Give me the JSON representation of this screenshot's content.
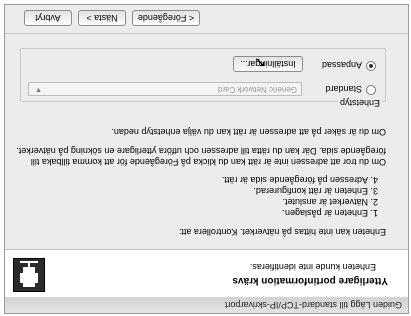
{
  "window": {
    "title": "Guiden Lägg till standard-TCP/IP-skrivarport"
  },
  "header": {
    "title": "Ytterligare portinformation krävs",
    "subtitle": "Enheten kunde inte identifieras.",
    "icon": "printer-network-icon"
  },
  "body": {
    "intro": "Enheten kan inte hittas på nätverket. Kontrollera att:",
    "checklist": [
      {
        "num": "1.",
        "text": "Enheten är påslagen."
      },
      {
        "num": "2.",
        "text": "Nätverket är anslutet."
      },
      {
        "num": "3.",
        "text": "Enheten är rätt konfigurerad."
      },
      {
        "num": "4.",
        "text": "Adressen på föregående sida är rätt."
      }
    ],
    "para1_line1": "Om du tror att adressen inte är rätt kan du klicka på Föregående för att komma tillbaka till",
    "para1_line2": "föregående sida. Där kan du rätta till adressen och utföra ytterligare en sökning på nätverket.",
    "para2": "Om du är säker på att adressen är rätt kan du välja enhetstyp nedan."
  },
  "device_type": {
    "label": "Enhetstyp",
    "standard_label": "Standard",
    "standard_value": "Generic Network Card",
    "custom_label": "Anpassad",
    "selected": "Anpassad",
    "settings_button": "Inställningar..."
  },
  "footer": {
    "back": "< Föregående",
    "next": "Nästa >",
    "cancel": "Avbryt"
  }
}
